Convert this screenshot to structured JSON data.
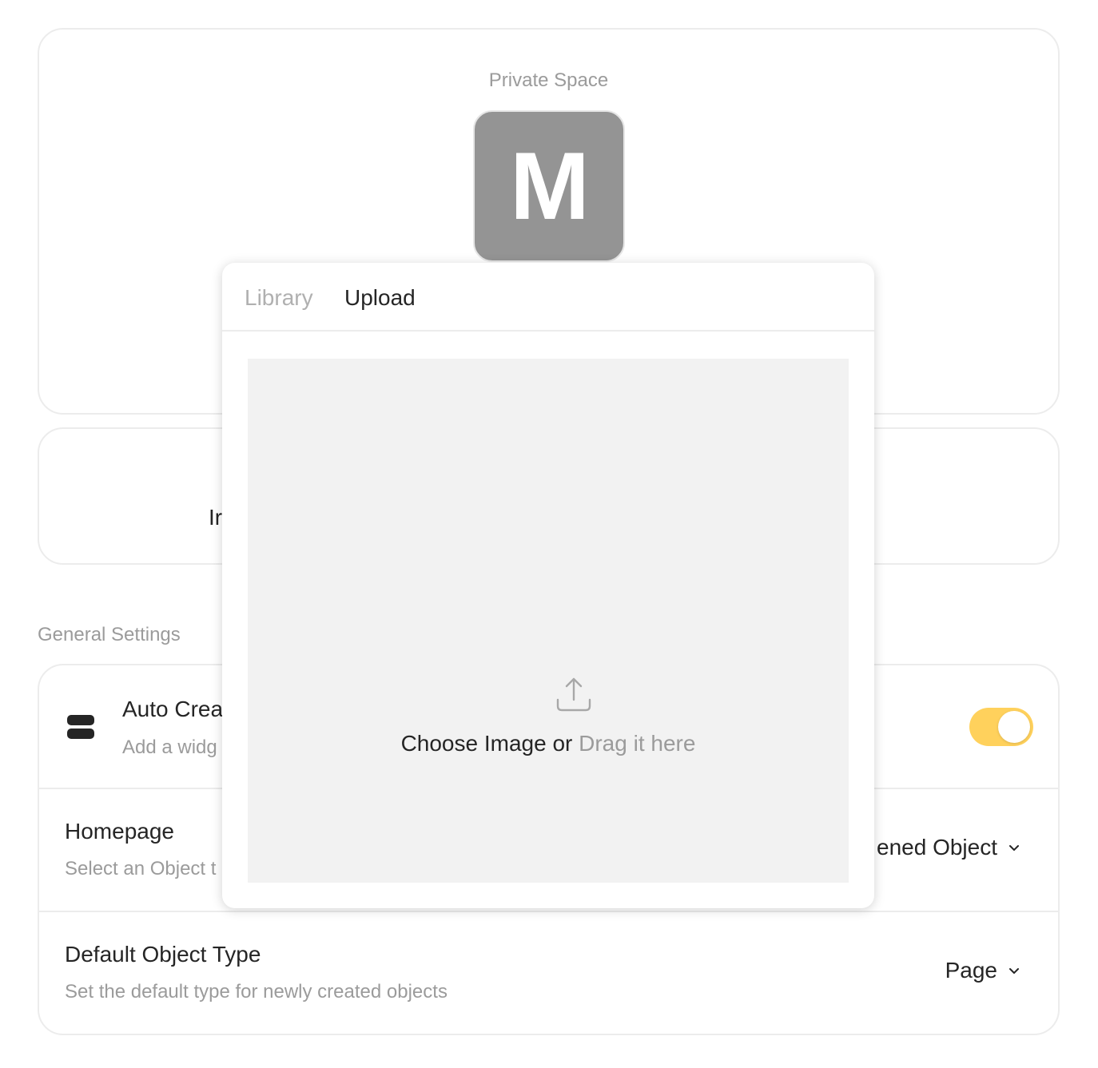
{
  "space": {
    "label": "Private Space",
    "avatar_letter": "M",
    "avatar_color": "#949494"
  },
  "invite": {
    "partial_text": "Ir"
  },
  "general_settings": {
    "section_label": "General Settings",
    "auto_create": {
      "icon": "widget-icon",
      "title": "Auto Crea",
      "description": "Add a widg",
      "toggle_on": true,
      "toggle_color": "#ffd15c"
    },
    "homepage": {
      "title": "Homepage",
      "description": "Select an Object t",
      "value": "ened Object"
    },
    "default_object_type": {
      "title": "Default Object Type",
      "description": "Set the default type for newly created objects",
      "value": "Page"
    }
  },
  "popup": {
    "tabs": [
      {
        "label": "Library",
        "active": false
      },
      {
        "label": "Upload",
        "active": true
      }
    ],
    "dropzone": {
      "icon": "upload-icon",
      "choose_text": "Choose Image or",
      "drag_text": "Drag it here"
    }
  }
}
